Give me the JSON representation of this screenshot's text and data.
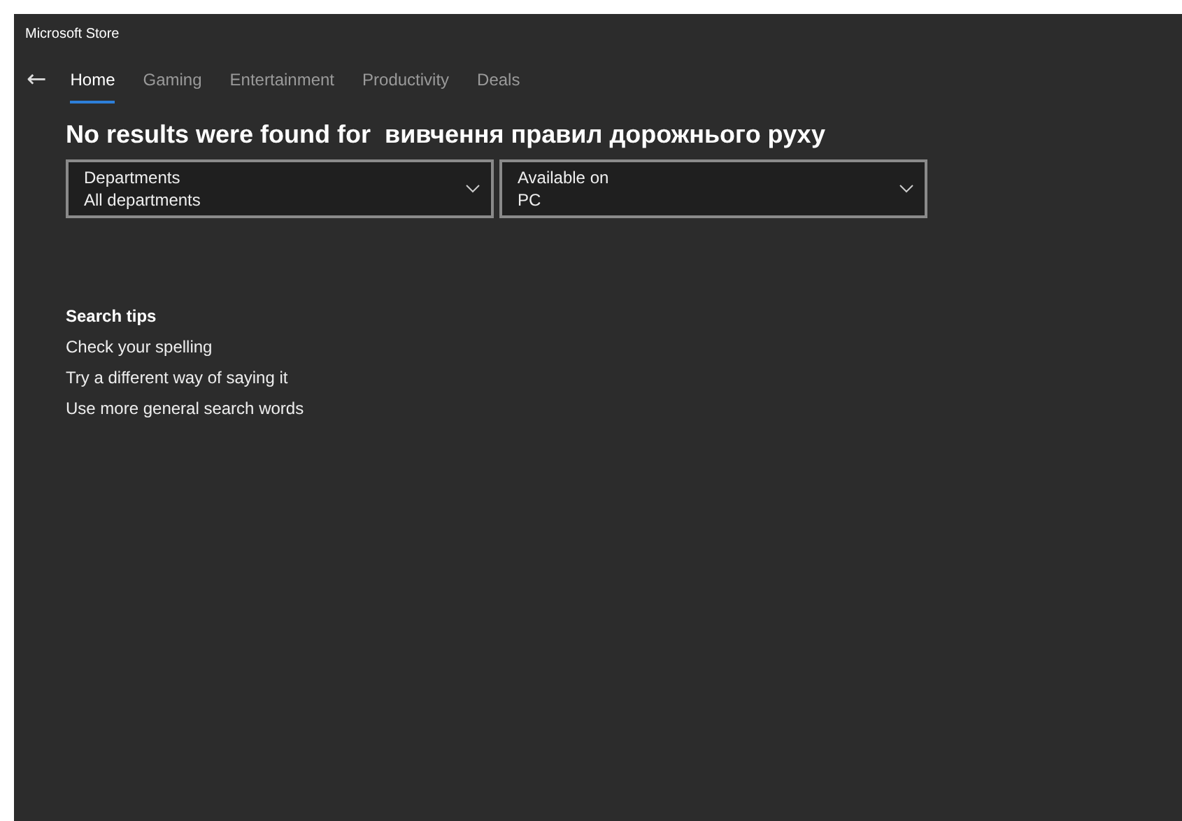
{
  "window": {
    "title": "Microsoft Store"
  },
  "nav": {
    "back": "←",
    "tabs": [
      {
        "label": "Home",
        "selected": true
      },
      {
        "label": "Gaming",
        "selected": false
      },
      {
        "label": "Entertainment",
        "selected": false
      },
      {
        "label": "Productivity",
        "selected": false
      },
      {
        "label": "Deals",
        "selected": false
      }
    ]
  },
  "heading": "No results were found for  вивчення правил дорожнього руху",
  "filters": [
    {
      "label": "Departments",
      "value": "All departments"
    },
    {
      "label": "Available on",
      "value": "PC"
    }
  ],
  "search_tips": {
    "title": "Search tips",
    "items": [
      "Check your spelling",
      "Try a different way of saying it",
      "Use more general search words"
    ]
  }
}
